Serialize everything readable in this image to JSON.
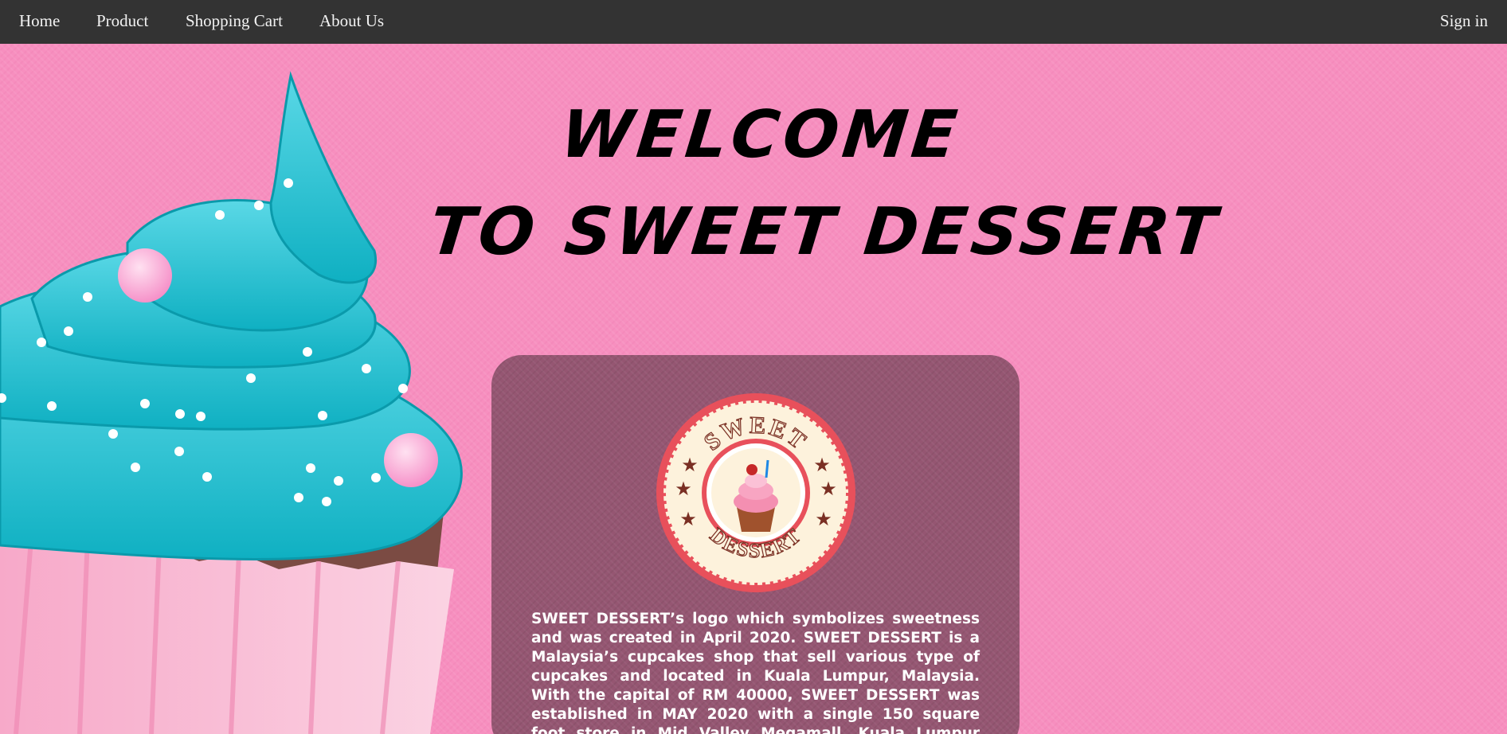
{
  "nav": {
    "home": "Home",
    "product": "Product",
    "cart": "Shopping Cart",
    "about": "About Us",
    "signin": "Sign in"
  },
  "hero": {
    "line1": "WELCOME",
    "line2": "TO SWEET DESSERT"
  },
  "logo": {
    "top_text": "SWEET",
    "bottom_text": "DESSERT"
  },
  "about": {
    "text": "SWEET DESSERT’s logo which symbolizes sweetness and was created in April 2020. SWEET DESSERT is a Malaysia’s cupcakes shop that sell various type of cupcakes and located in Kuala Lumpur, Malaysia. With the capital of RM 40000, SWEET DESSERT was established in MAY 2020 with a single 150 square foot store in Mid Valley Megamall, Kuala Lumpur founded by Wan Abdul Qayyum or known"
  },
  "colors": {
    "navbar": "#333333",
    "page_background": "#f78fbf",
    "card": "#955672",
    "frosting": "#1fc3d4",
    "logo_ring": "#e8505b"
  }
}
